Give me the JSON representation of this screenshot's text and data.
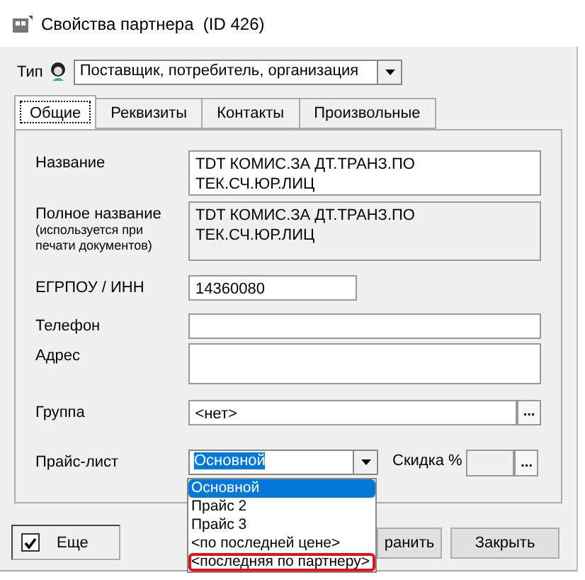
{
  "window": {
    "title": "Свойства партнера  (ID 426)"
  },
  "type": {
    "label": "Тип",
    "value": "Поставщик, потребитель, организация"
  },
  "tabs": [
    {
      "label": "Общие",
      "selected": true
    },
    {
      "label": "Реквизиты",
      "selected": false
    },
    {
      "label": "Контакты",
      "selected": false
    },
    {
      "label": "Произвольные",
      "selected": false
    }
  ],
  "fields": [
    {
      "kind": "text",
      "label": "Название",
      "value": "TDT КОМИС.ЗА ДТ.ТРАНЗ.ПО\nТЕК.СЧ.ЮР.ЛИЦ",
      "disabled": false
    },
    {
      "kind": "text",
      "label": "Полное название",
      "note": "(используется при\nпечати документов)",
      "value": "TDT КОМИС.ЗА ДТ.ТРАНЗ.ПО\nТЕК.СЧ.ЮР.ЛИЦ",
      "disabled": true
    },
    {
      "kind": "short",
      "label": "ЕГРПОУ / ИНН",
      "value": "14360080",
      "disabled": false
    },
    {
      "kind": "line",
      "label": "Телефон",
      "disabled": false
    },
    {
      "kind": "area",
      "label": "Адрес",
      "disabled": false
    },
    {
      "kind": "browse",
      "label": "Группа",
      "value": "<нет>",
      "button": "...",
      "disabled": false
    }
  ],
  "price": {
    "label": "Прайс-лист",
    "value": "Основной",
    "discount_label": "Скидка %",
    "discount_button": "...",
    "options": [
      {
        "label": "Основной",
        "selected": true,
        "circled": false
      },
      {
        "label": "Прайс 2",
        "selected": false,
        "circled": false
      },
      {
        "label": "Прайс 3",
        "selected": false,
        "circled": false
      },
      {
        "label": "<по последней цене>",
        "selected": false,
        "circled": false
      },
      {
        "label": "<последняя по партнеру>",
        "selected": false,
        "circled": true
      }
    ]
  },
  "more": {
    "label": "Еще",
    "checked": true
  },
  "buttons": [
    "ранить",
    "Закрыть"
  ]
}
